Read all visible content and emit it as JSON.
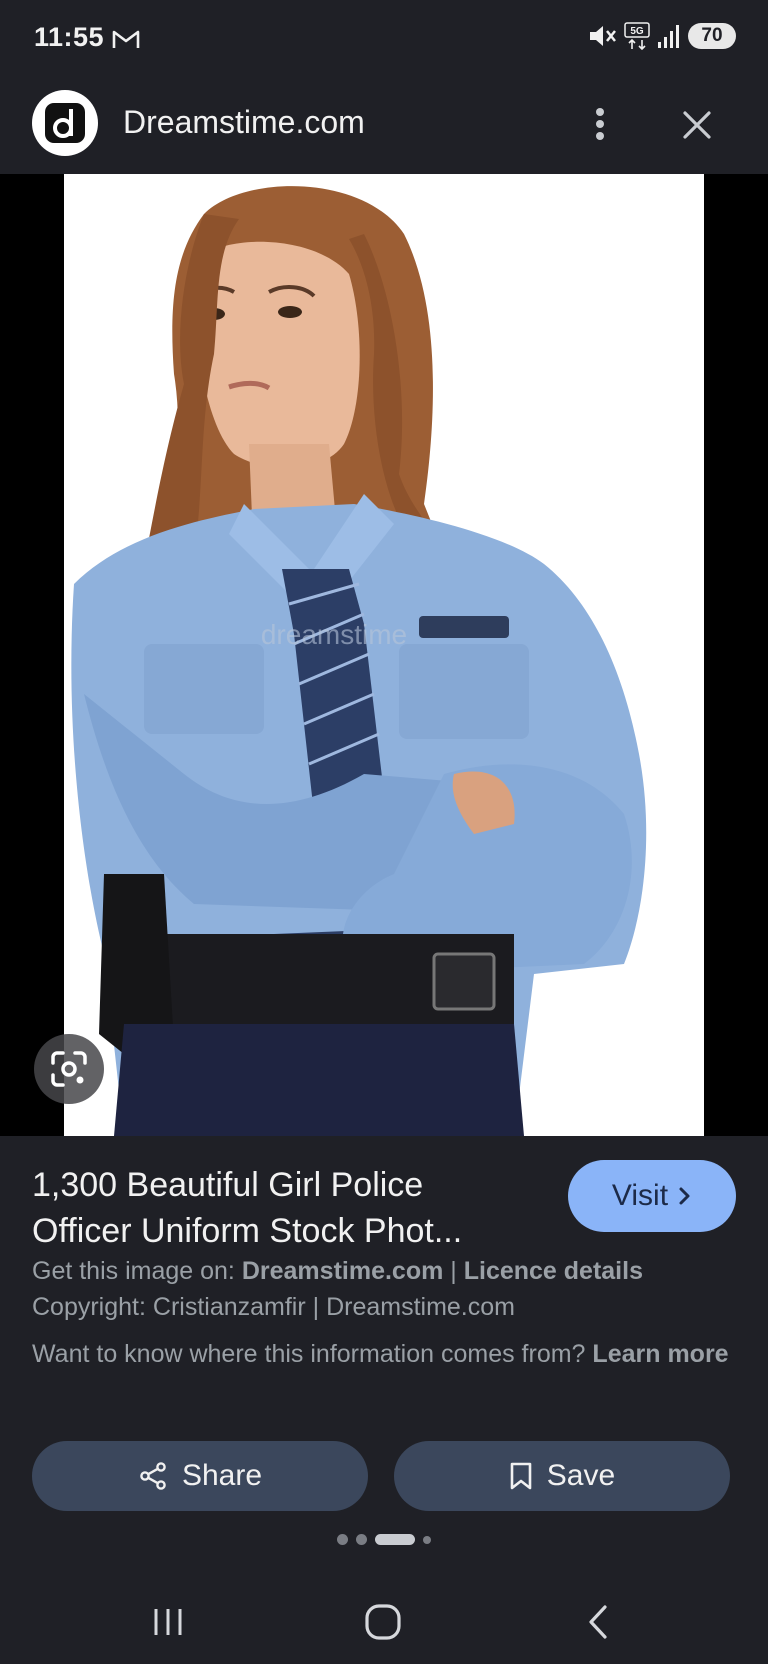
{
  "status_bar": {
    "time": "11:55",
    "battery": "70",
    "network": "5G"
  },
  "header": {
    "site_name": "Dreamstime.com",
    "logo_letter": "d"
  },
  "image": {
    "watermark": "dreamstime"
  },
  "result": {
    "title": "1,300 Beautiful Girl Police Officer Uniform Stock Phot...",
    "visit_label": "Visit",
    "get_image_prefix": "Get this image on:",
    "get_image_source": "Dreamstime.com",
    "separator": "|",
    "licence_label": "Licence details",
    "copyright": "Copyright: Cristianzamfir | Dreamstime.com",
    "info_question": "Want to know where this information comes from?",
    "learn_more": "Learn more"
  },
  "actions": {
    "share_label": "Share",
    "save_label": "Save"
  },
  "colors": {
    "background": "#1f2026",
    "accent": "#8ab4f8",
    "button_bg": "#3b475c"
  }
}
